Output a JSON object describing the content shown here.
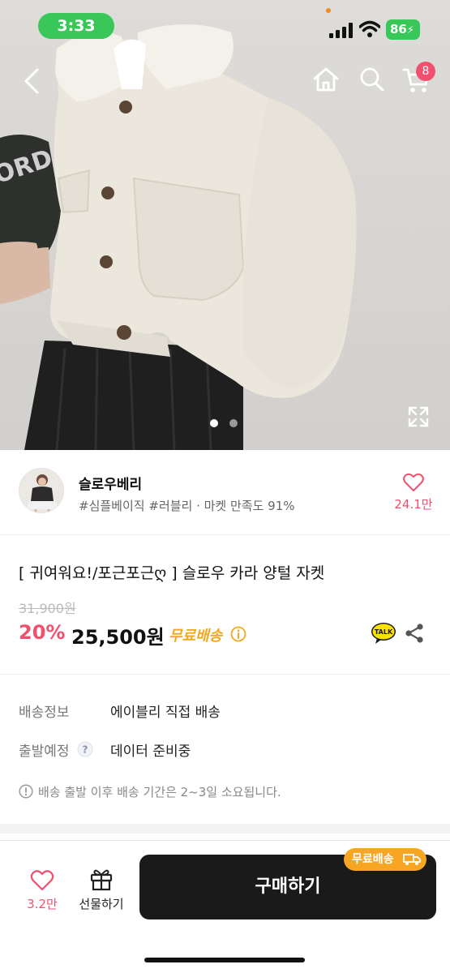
{
  "status_bar": {
    "time": "3:33",
    "battery": "86"
  },
  "nav": {
    "cart_count": "8"
  },
  "gallery": {
    "total_images": 2,
    "active_index": 0,
    "colors": {
      "active": "#ffffff",
      "inactive": "#9a9a9a"
    }
  },
  "seller": {
    "name": "슬로우베리",
    "tags": "#심플베이직 #러블리 · 마켓 만족도 91%",
    "like_count": "24.1만"
  },
  "product": {
    "title": "[ 귀여워요!/포근포근ღ ] 슬로우 카라 양털 자켓",
    "original_price": "31,900원",
    "discount": "20%",
    "price": "25,500원",
    "free_shipping": "무료배송",
    "talk_label": "TALK"
  },
  "shipping": {
    "info_label": "배송정보",
    "info_value": "에이블리 직접 배송",
    "dispatch_label": "출발예정",
    "dispatch_value": "데이터 준비중",
    "notice": "배송 출발 이후 배송 기간은 2~3일 소요됩니다."
  },
  "bottom_bar": {
    "like_count": "3.2만",
    "gift_label": "선물하기",
    "buy_label": "구매하기",
    "free_tag": "무료배송"
  },
  "colors": {
    "accent_pink": "#f0506e",
    "free_ship_orange": "#f6a623",
    "status_green": "#39c759"
  }
}
